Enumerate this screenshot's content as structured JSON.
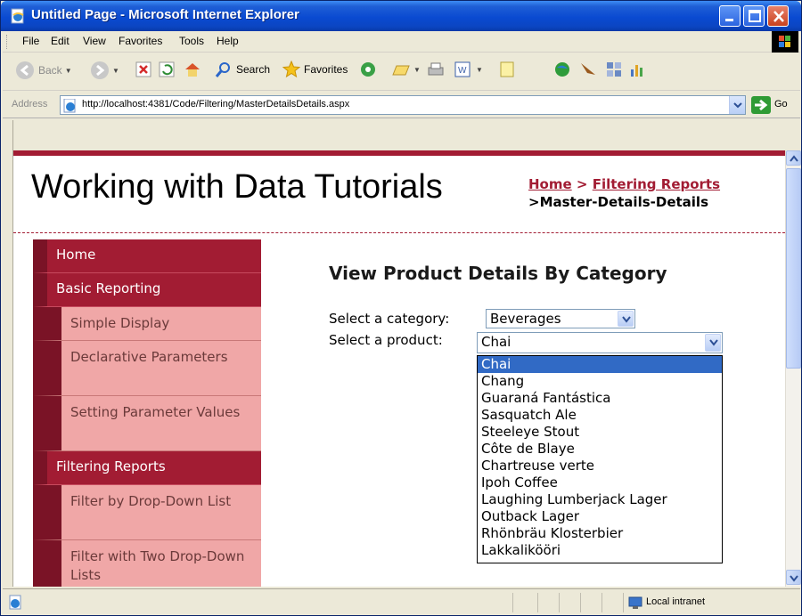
{
  "window": {
    "title": "Untitled Page - Microsoft Internet Explorer"
  },
  "menu": [
    "File",
    "Edit",
    "View",
    "Favorites",
    "Tools",
    "Help"
  ],
  "toolbar": {
    "back_label": "Back",
    "search_label": "Search",
    "favorites_label": "Favorites"
  },
  "address": {
    "label": "Address",
    "url": "http://localhost:4381/Code/Filtering/MasterDetailsDetails.aspx",
    "go_label": "Go"
  },
  "page": {
    "site_title": "Working with Data Tutorials",
    "breadcrumb": {
      "home": "Home",
      "sep": ">",
      "section": "Filtering Reports",
      "current": ">Master-Details-Details"
    },
    "heading": "View Product Details By Category",
    "category_label": "Select a category:",
    "category_value": "Beverages",
    "product_label": "Select a product:",
    "product_value": "Chai",
    "product_options": [
      "Chai",
      "Chang",
      "Guaraná Fantástica",
      "Sasquatch Ale",
      "Steeleye Stout",
      "Côte de Blaye",
      "Chartreuse verte",
      "Ipoh Coffee",
      "Laughing Lumberjack Lager",
      "Outback Lager",
      "Rhönbräu Klosterbier",
      "Lakkalikööri"
    ],
    "selected_option": "Chai"
  },
  "nav": [
    {
      "label": "Home",
      "level": "top"
    },
    {
      "label": "Basic Reporting",
      "level": "top"
    },
    {
      "label": "Simple Display",
      "level": "sub"
    },
    {
      "label": "Declarative Parameters",
      "level": "sub"
    },
    {
      "label": "Setting Parameter Values",
      "level": "sub"
    },
    {
      "label": "Filtering Reports",
      "level": "top"
    },
    {
      "label": "Filter by Drop-Down List",
      "level": "sub"
    },
    {
      "label": "Filter with Two Drop-Down Lists",
      "level": "sub"
    }
  ],
  "status": {
    "zone": "Local intranet"
  },
  "colors": {
    "brand": "#a21c33",
    "nav_sub_bg": "#f0a7a7",
    "selection": "#316ac5"
  }
}
